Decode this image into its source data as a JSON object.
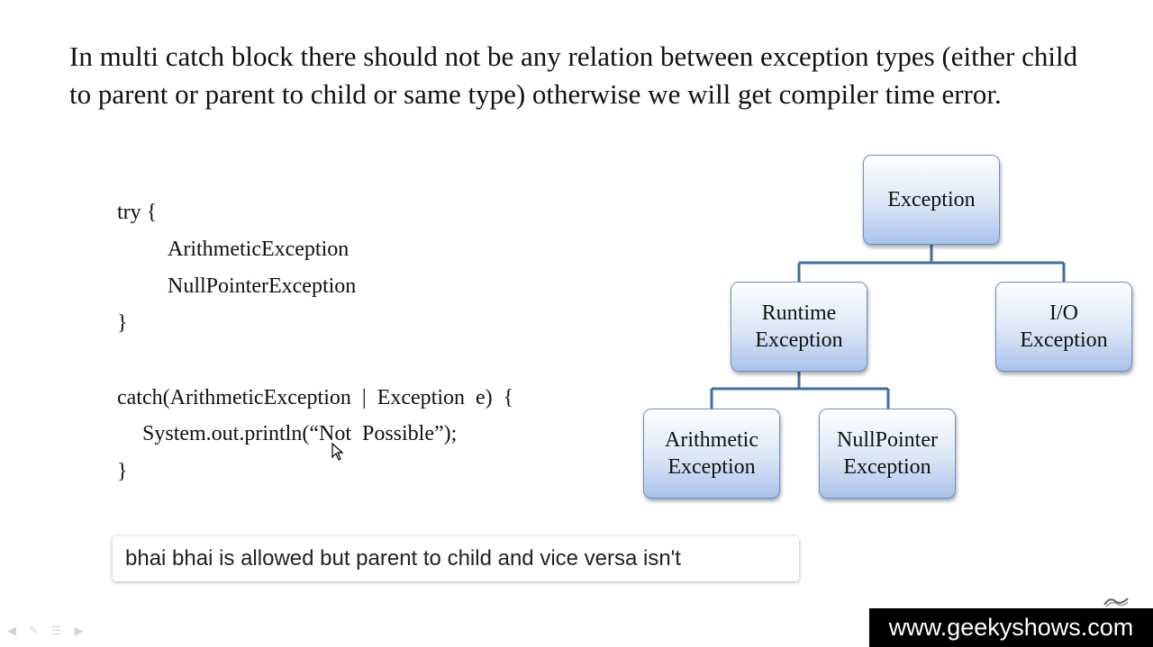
{
  "slide": {
    "text": "In multi catch block there should not be any relation between exception types (either child to parent or parent to child or same type) otherwise we will get compiler time error."
  },
  "code": {
    "lines": [
      "try {",
      "ArithmeticException",
      "NullPointerException",
      "}",
      "catch(ArithmeticException  |  Exception  e)  {",
      "System.out.println(“Not  Possible”);",
      "}"
    ]
  },
  "hierarchy": {
    "root": "Exception",
    "runtime": "Runtime\nException",
    "io": "I/O\nException",
    "arithmetic": "Arithmetic\nException",
    "nullpointer": "NullPointer\nException",
    "connector_color": "#3f6ea6"
  },
  "caption": {
    "text": "bhai bhai is allowed but parent to child and vice versa isn't"
  },
  "watermark": {
    "text": "www.geekyshows.com"
  },
  "player_controls": {
    "icons": [
      "back-arrow-icon",
      "pen-icon",
      "menu-icon",
      "forward-arrow-icon"
    ]
  }
}
